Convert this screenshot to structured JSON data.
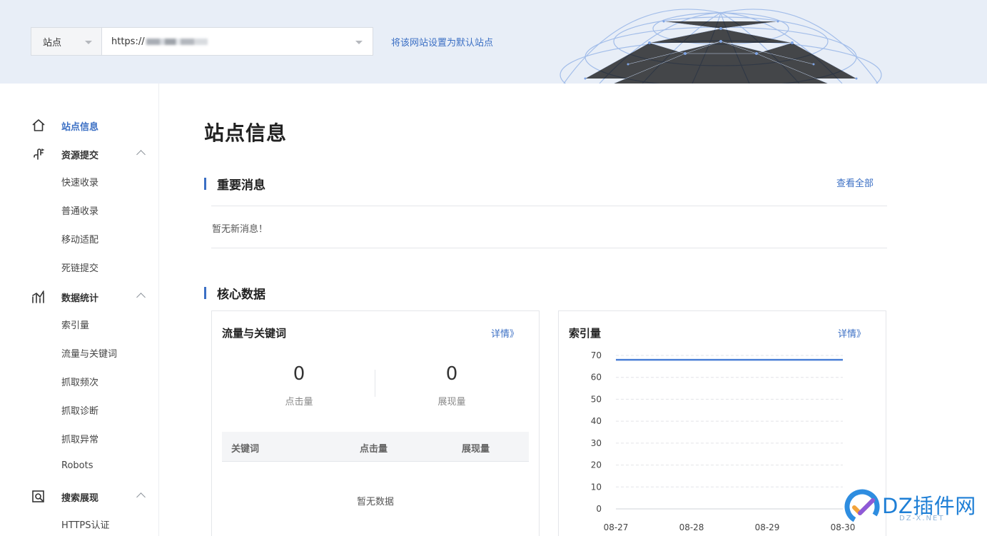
{
  "header": {
    "site_type": "站点",
    "site_url": "https://",
    "set_default": "将该网站设置为默认站点"
  },
  "sidebar": {
    "groups": [
      {
        "label": "站点信息",
        "icon": "home-icon"
      },
      {
        "label": "资源提交",
        "icon": "upload-hand-icon",
        "items": [
          "快速收录",
          "普通收录",
          "移动适配",
          "死链提交"
        ]
      },
      {
        "label": "数据统计",
        "icon": "stats-icon",
        "items": [
          "索引量",
          "流量与关键词",
          "抓取频次",
          "抓取诊断",
          "抓取异常",
          "Robots"
        ]
      },
      {
        "label": "搜索展现",
        "icon": "search-display-icon",
        "items": [
          "HTTPS认证"
        ]
      }
    ]
  },
  "main": {
    "title": "站点信息",
    "important": {
      "title": "重要消息",
      "view_all": "查看全部",
      "empty": "暂无新消息！"
    },
    "core": {
      "title": "核心数据",
      "traffic": {
        "title": "流量与关键词",
        "link": "详情》",
        "clicks_value": "0",
        "clicks_label": "点击量",
        "impressions_value": "0",
        "impressions_label": "展现量",
        "columns": [
          "关键词",
          "点击量",
          "展现量"
        ],
        "empty": "暂无数据"
      },
      "index": {
        "title": "索引量",
        "link": "详情》"
      }
    }
  },
  "chart_data": {
    "type": "line",
    "x": [
      "08-27",
      "08-28",
      "08-29",
      "08-30"
    ],
    "series": [
      {
        "values": [
          68,
          68,
          68,
          68
        ]
      }
    ],
    "y_ticks": [
      0,
      10,
      20,
      30,
      40,
      50,
      60,
      70
    ],
    "ylim": [
      0,
      70
    ],
    "grid": true,
    "color": "#4a7fd6"
  },
  "watermark": {
    "text": "DZ插件网",
    "sub": "DZ-X.NET"
  }
}
